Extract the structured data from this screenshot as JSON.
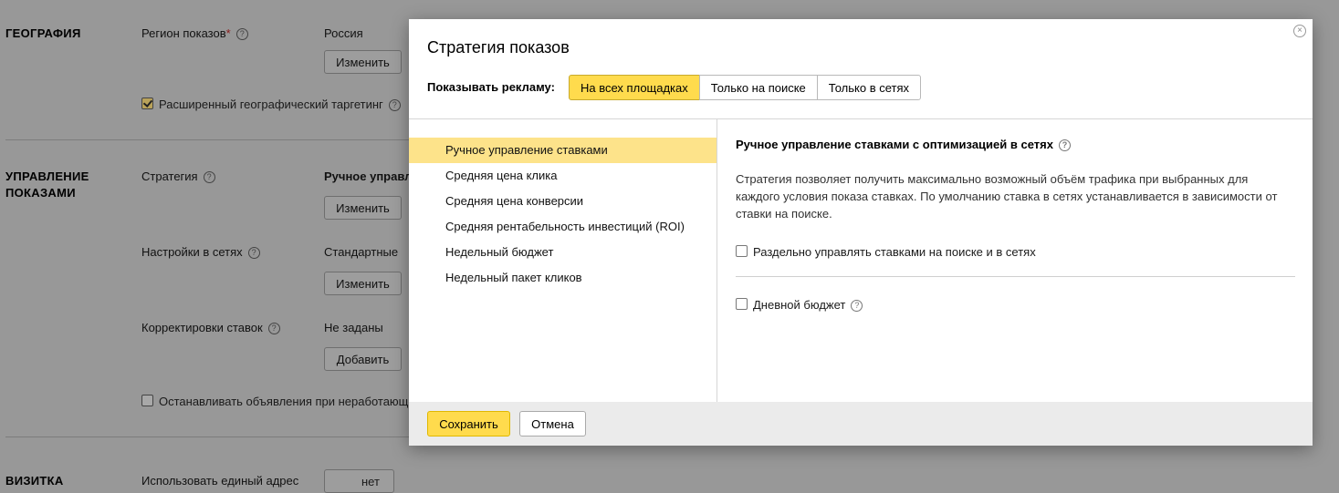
{
  "background": {
    "geo": {
      "heading": "ГЕОГРАФИЯ",
      "region_label": "Регион показов",
      "region_required": "*",
      "region_value": "Россия",
      "change_button": "Изменить",
      "extended_targeting_label": "Расширенный географический таргетинг",
      "extended_targeting_checked": true
    },
    "management": {
      "heading_line1": "УПРАВЛЕНИЕ",
      "heading_line2": "ПОКАЗАМИ",
      "strategy_label": "Стратегия",
      "strategy_value": "Ручное управл",
      "strategy_change": "Изменить",
      "network_label": "Настройки в сетях",
      "network_value": "Стандартные",
      "network_change": "Изменить",
      "bid_adj_label": "Корректировки ставок",
      "bid_adj_value": "Не заданы",
      "bid_adj_add": "Добавить",
      "stop_ads_label": "Останавливать объявления при неработающ"
    },
    "vcard": {
      "heading": "ВИЗИТКА",
      "single_address_label": "Использовать единый адрес",
      "toggle_no": "нет"
    }
  },
  "modal": {
    "title": "Стратегия показов",
    "show_ads_label": "Показывать рекламу:",
    "placements": [
      {
        "label": "На всех площадках",
        "active": true
      },
      {
        "label": "Только на поиске",
        "active": false
      },
      {
        "label": "Только в сетях",
        "active": false
      }
    ],
    "strategies": [
      {
        "label": "Ручное управление ставками",
        "active": true
      },
      {
        "label": "Средняя цена клика",
        "active": false
      },
      {
        "label": "Средняя цена конверсии",
        "active": false
      },
      {
        "label": "Средняя рентабельность инвестиций (ROI)",
        "active": false
      },
      {
        "label": "Недельный бюджет",
        "active": false
      },
      {
        "label": "Недельный пакет кликов",
        "active": false
      }
    ],
    "detail": {
      "title": "Ручное управление ставками с оптимизацией в сетях",
      "description": "Стратегия позволяет получить максимально возможный объём трафика при выбранных для каждого условия показа ставках. По умолчанию ставка в сетях устанавливается в зависимости от ставки на поиске.",
      "separate_bids_label": "Раздельно управлять ставками на поиске и в сетях",
      "daily_budget_label": "Дневной бюджет"
    },
    "save_button": "Сохранить",
    "cancel_button": "Отмена",
    "close_symbol": "×",
    "help_symbol": "?"
  },
  "colors": {
    "accent_yellow": "#ffdb4d",
    "selected_item": "#fde38a",
    "overlay_gray": "#989898"
  }
}
